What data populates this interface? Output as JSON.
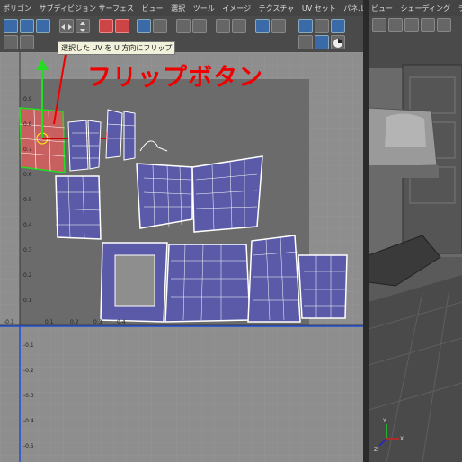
{
  "menubar": {
    "items": [
      "ポリゴン",
      "サブディビジョン サーフェス",
      "ビュー",
      "選択",
      "ツール",
      "イメージ",
      "テクスチャ",
      "UV セット",
      "パネル"
    ]
  },
  "viewport_menubar": {
    "items": [
      "ビュー",
      "シェーディング",
      "ラ"
    ]
  },
  "tooltip": {
    "text": "選択した UV を U 方向にフリップ"
  },
  "annotation": {
    "text": "フリップボタン",
    "color": "#e00000"
  },
  "uv_editor": {
    "tick_labels_y": [
      "0.9",
      "0.8",
      "0.7",
      "0.6",
      "0.5",
      "0.4",
      "0.3",
      "0.2",
      "0.1",
      "-0.1",
      "-0.2",
      "-0.3",
      "-0.4",
      "-0.5"
    ],
    "tick_labels_x": [
      "-0.1",
      "0.1",
      "0.2",
      "0.3",
      "0.4"
    ],
    "colors": {
      "uv_shell_fill": "#5a5aa8",
      "uv_line": "#ffffff",
      "selected_fill": "#c85050",
      "selected_line": "#22dd22",
      "grid_dark": "#6b6b6b",
      "grid_light": "#8e8e8e"
    }
  },
  "viewport": {
    "axis_labels": [
      "X",
      "Y",
      "Z"
    ]
  },
  "icons": [
    "uv-texture-editor-icon",
    "flip-u-icon",
    "flip-v-icon",
    "rotate-icon",
    "grid-icon",
    "checker-icon",
    "color-wheel-icon"
  ]
}
